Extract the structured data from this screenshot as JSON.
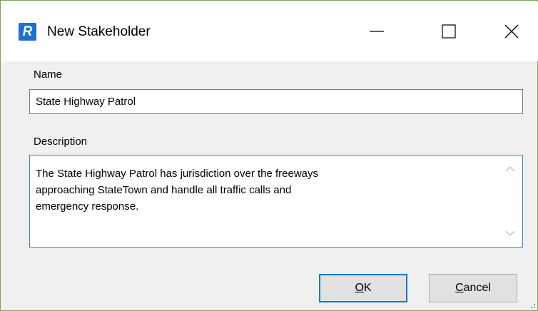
{
  "window": {
    "title": "New Stakeholder",
    "app_icon_letter": "R",
    "controls": {
      "minimize": "minimize",
      "maximize": "maximize",
      "close": "close"
    }
  },
  "form": {
    "name_label": "Name",
    "name_value": "State Highway Patrol",
    "description_label": "Description",
    "description_value": "The State Highway Patrol has jurisdiction over the freeways\napproaching StateTown and handle all traffic calls and\nemergency response."
  },
  "buttons": {
    "ok_mnemonic": "O",
    "ok_rest": "K",
    "cancel_mnemonic": "C",
    "cancel_rest": "ancel"
  },
  "colors": {
    "accent": "#0078d7",
    "app_icon": "#1e6fd0",
    "frame": "#7aa65a"
  },
  "icons": [
    "app-r-icon",
    "minimize-icon",
    "maximize-icon",
    "close-icon",
    "scroll-up-arrow-icon",
    "scroll-down-arrow-icon",
    "resize-grip-icon"
  ]
}
